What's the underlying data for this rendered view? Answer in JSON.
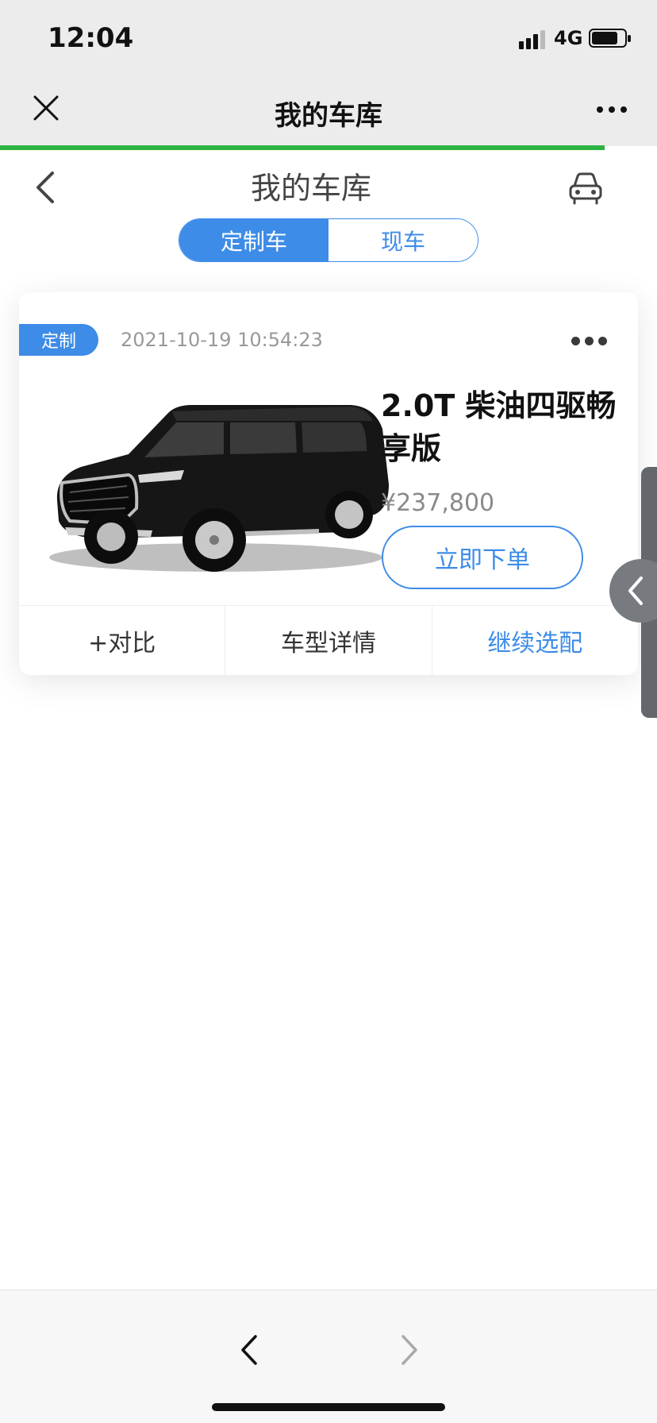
{
  "status": {
    "time": "12:04",
    "network": "4G"
  },
  "wechat": {
    "title": "我的车库"
  },
  "page": {
    "title": "我的车库"
  },
  "tabs": [
    {
      "label": "定制车",
      "active": true
    },
    {
      "label": "现车",
      "active": false
    }
  ],
  "card": {
    "tag": "定制",
    "datetime": "2021-10-19 10:54:23",
    "car_name": "2.0T 柴油四驱畅享版",
    "price": "¥237,800",
    "order_label": "立即下单",
    "actions": [
      "+对比",
      "车型详情",
      "继续选配"
    ]
  },
  "colors": {
    "accent": "#3d8ce8",
    "progress": "#2db341",
    "statusbar_bg": "#ececec"
  },
  "icons": [
    "close-icon",
    "more-icon",
    "back-icon",
    "garage-icon",
    "chevron-left-icon",
    "chevron-right-icon"
  ]
}
